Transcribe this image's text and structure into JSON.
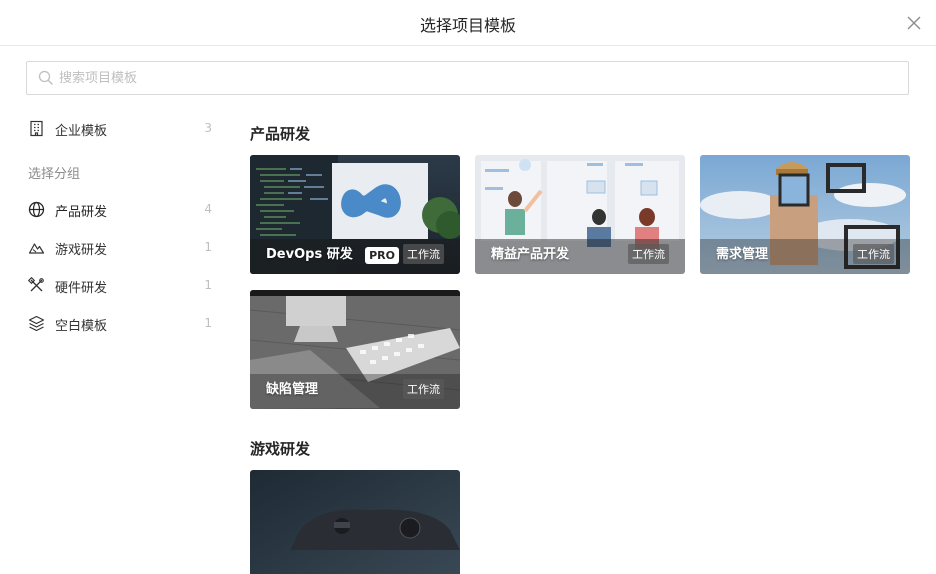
{
  "dialog": {
    "title": "选择项目模板",
    "close_icon": "close-icon"
  },
  "search": {
    "placeholder": "搜索项目模板",
    "value": ""
  },
  "sidebar": {
    "enterprise": {
      "label": "企业模板",
      "count": "3",
      "icon": "building-icon"
    },
    "group_heading": "选择分组",
    "items": [
      {
        "label": "产品研发",
        "count": "4",
        "icon": "globe-icon",
        "selected": true
      },
      {
        "label": "游戏研发",
        "count": "1",
        "icon": "mountain-icon"
      },
      {
        "label": "硬件研发",
        "count": "1",
        "icon": "tools-icon"
      },
      {
        "label": "空白模板",
        "count": "1",
        "icon": "layers-icon"
      }
    ]
  },
  "sections": [
    {
      "title": "产品研发",
      "cards": [
        {
          "label": "DevOps 研发",
          "pro": "PRO",
          "badge": "工作流"
        },
        {
          "label": "精益产品开发",
          "badge": "工作流"
        },
        {
          "label": "需求管理",
          "badge": "工作流"
        },
        {
          "label": "缺陷管理",
          "badge": "工作流"
        }
      ]
    },
    {
      "title": "游戏研发",
      "cards": [
        {
          "label": "",
          "badge": ""
        }
      ]
    }
  ]
}
